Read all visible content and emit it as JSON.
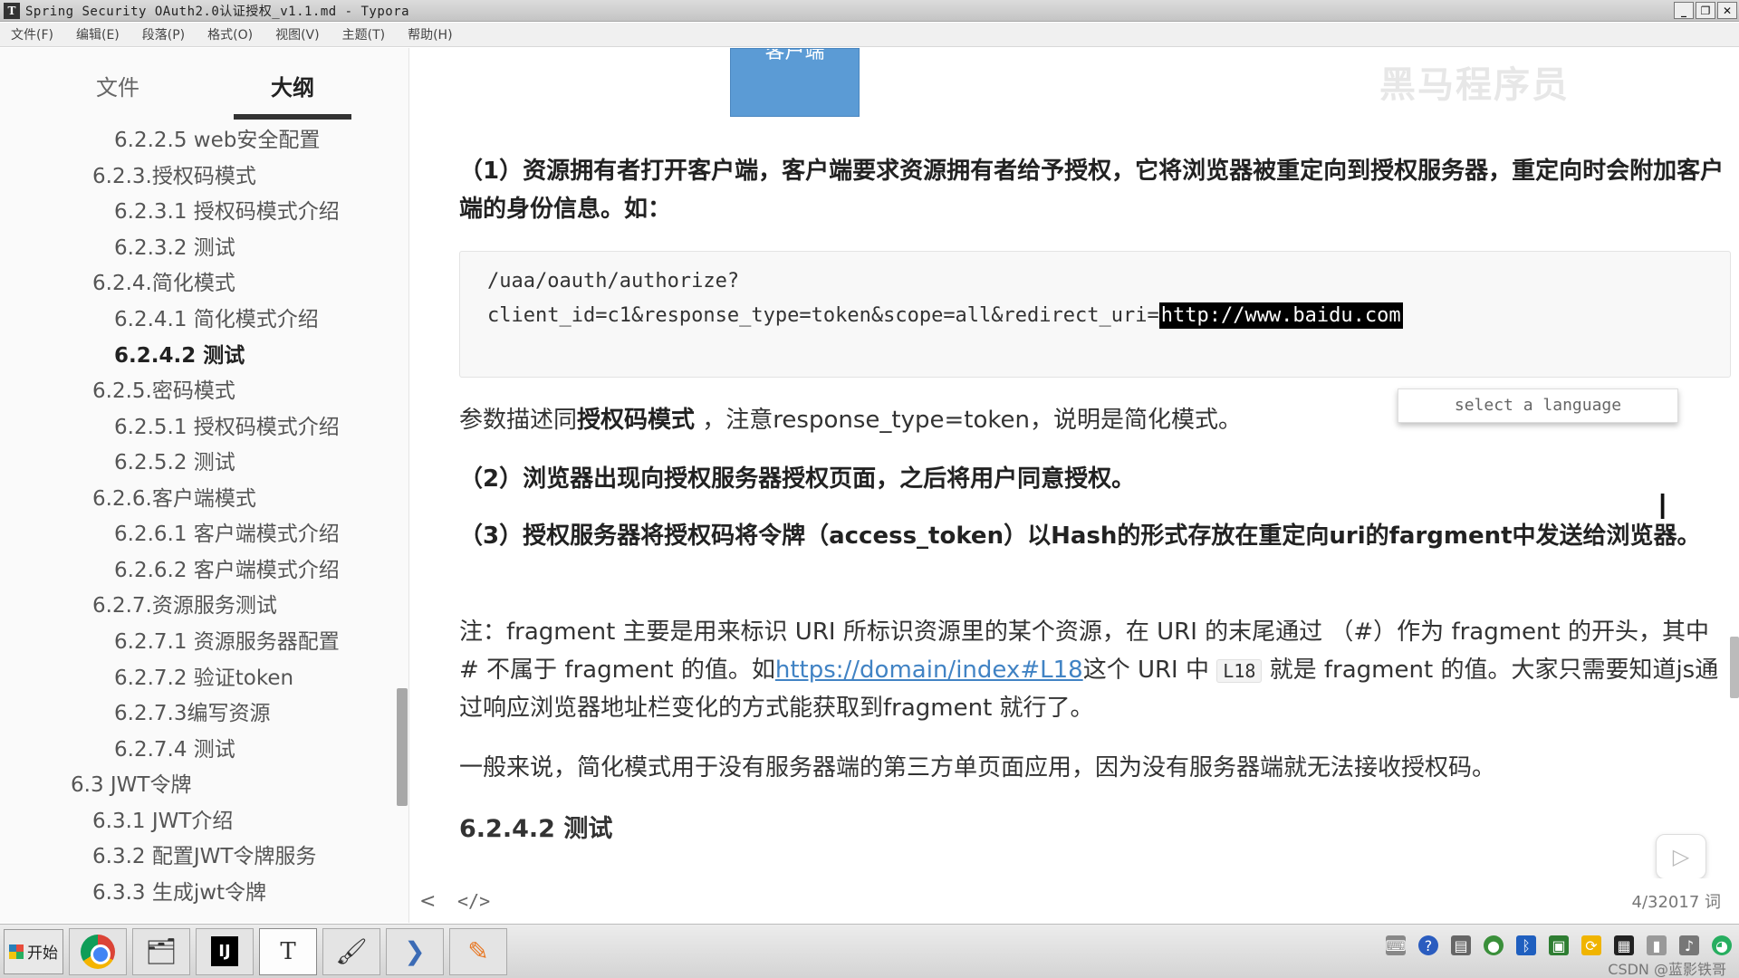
{
  "window": {
    "title": "Spring Security OAuth2.0认证授权_v1.1.md - Typora",
    "controls": [
      "_",
      "❐",
      "✕"
    ]
  },
  "menu": [
    "文件(F)",
    "编辑(E)",
    "段落(P)",
    "格式(O)",
    "视图(V)",
    "主题(T)",
    "帮助(H)"
  ],
  "sidebar": {
    "tabs": {
      "files": "文件",
      "outline": "大纲"
    },
    "outline": [
      "6.2.2.5 web安全配置",
      "6.2.3.授权码模式",
      "6.2.3.1 授权码模式介绍",
      "6.2.3.2 测试",
      "6.2.4.简化模式",
      "6.2.4.1 简化模式介绍",
      "6.2.4.2 测试",
      "6.2.5.密码模式",
      "6.2.5.1 授权码模式介绍",
      "6.2.5.2 测试",
      "6.2.6.客户端模式",
      "6.2.6.1 客户端模式介绍",
      "6.2.6.2 客户端模式介绍",
      "6.2.7.资源服务测试",
      "6.2.7.1 资源服务器配置",
      "6.2.7.2 验证token",
      "6.2.7.3编写资源",
      "6.2.7.4 测试",
      "6.3 JWT令牌",
      "6.3.1 JWT介绍",
      "6.3.2 配置JWT令牌服务",
      "6.3.3 生成jwt令牌"
    ],
    "active_item": "6.2.4.2 测试"
  },
  "content": {
    "box_label": "客户端",
    "watermark": "黑马程序员",
    "step1": "（1）资源拥有者打开客户端，客户端要求资源拥有者给予授权，它将浏览器被重定向到授权服务器，重定向时会附加客户端的身份信息。如：",
    "code_line1": "/uaa/oauth/authorize?",
    "code_line2_prefix": "client_id=c1&response_type=token&scope=all&redirect_uri=",
    "code_line2_highlight": "http://www.baidu.com",
    "lang_select": "select a language",
    "param_prefix": "参数描述同",
    "param_bold": "授权码模式",
    "param_suffix": " ，注意response_type=token，说明是简化模式。",
    "step2": "（2）浏览器出现向授权服务器授权页面，之后将用户同意授权。",
    "step3": "（3）授权服务器将授权码将令牌（access_token）以Hash的形式存放在重定向uri的fargment中发送给浏览器。",
    "note_prefix": "注：fragment 主要是用来标识 URI 所标识资源里的某个资源，在 URI 的末尾通过 （#）作为 fragment 的开头，其中 # 不属于 fragment 的值。如",
    "note_link": "https://domain/index#L18",
    "note_mid": "这个 URI 中 ",
    "note_code": "L18",
    "note_suffix": " 就是 fragment 的值。大家只需要知道js通过响应浏览器地址栏变化的方式能获取到fragment 就行了。",
    "general": "一般来说，简化模式用于没有服务器端的第三方单页面应用，因为没有服务器端就无法接收授权码。",
    "heading": "6.2.4.2 测试"
  },
  "footer": {
    "back": "<",
    "source": "</>",
    "word_count": "4/32017 词"
  },
  "taskbar": {
    "start": "开始",
    "apps": [
      "chrome",
      "file-manager",
      "intellij",
      "typora",
      "paint",
      "plugin",
      "pencil"
    ],
    "tray_label": "CSDN @蓝影铁哥"
  }
}
